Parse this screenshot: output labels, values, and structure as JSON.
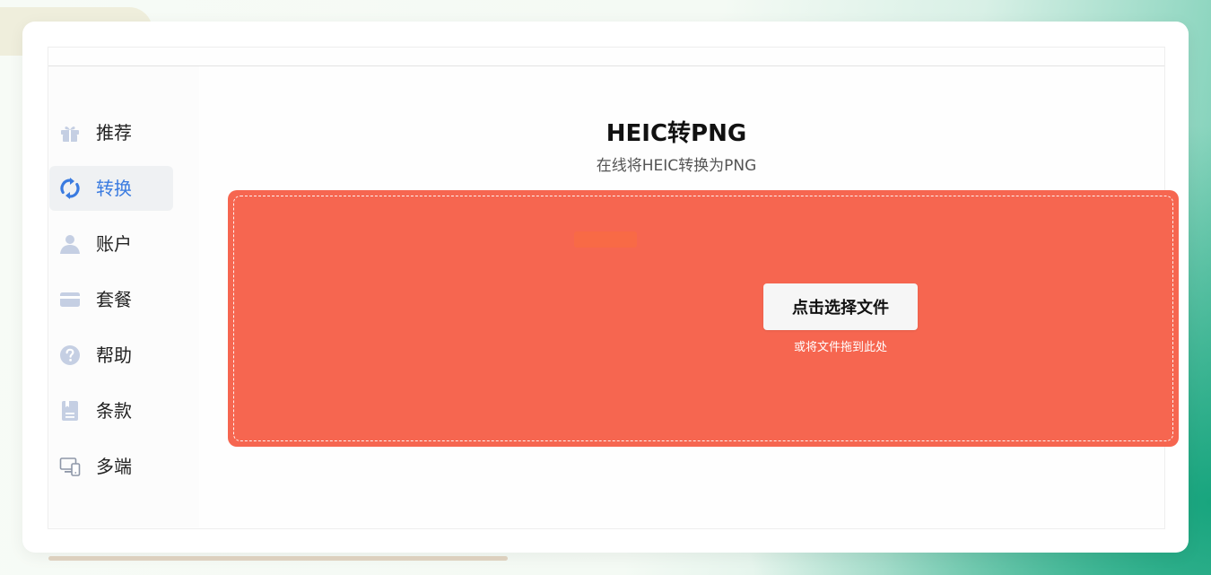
{
  "sidebar": {
    "items": [
      {
        "label": "推荐",
        "icon": "gift-icon",
        "active": false
      },
      {
        "label": "转换",
        "icon": "convert-icon",
        "active": true
      },
      {
        "label": "账户",
        "icon": "user-icon",
        "active": false
      },
      {
        "label": "套餐",
        "icon": "card-icon",
        "active": false
      },
      {
        "label": "帮助",
        "icon": "help-icon",
        "active": false
      },
      {
        "label": "条款",
        "icon": "document-icon",
        "active": false
      },
      {
        "label": "多端",
        "icon": "devices-icon",
        "active": false
      }
    ]
  },
  "main": {
    "title": "HEIC转PNG",
    "subtitle": "在线将HEIC转换为PNG"
  },
  "dropzone": {
    "button_label": "点击选择文件",
    "hint": "或将文件拖到此处"
  },
  "colors": {
    "accent": "#3a7be0",
    "icon_muted": "#c5cfe3",
    "dropzone": "#f66650",
    "active_background": "#eff1f3"
  }
}
